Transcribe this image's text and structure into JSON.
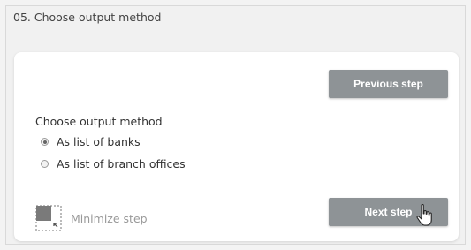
{
  "step": {
    "title": "05. Choose output method"
  },
  "buttons": {
    "previous_label": "Previous step",
    "next_label": "Next step"
  },
  "output_method": {
    "label": "Choose output method",
    "options": [
      {
        "label": "As list of banks",
        "selected": true
      },
      {
        "label": "As list of branch offices",
        "selected": false
      }
    ]
  },
  "minimize": {
    "label": "Minimize step",
    "icon": "minimize-icon"
  },
  "colors": {
    "button_bg": "#8e9396",
    "button_text": "#ffffff",
    "panel_bg": "#f1f1f1",
    "card_bg": "#ffffff"
  }
}
